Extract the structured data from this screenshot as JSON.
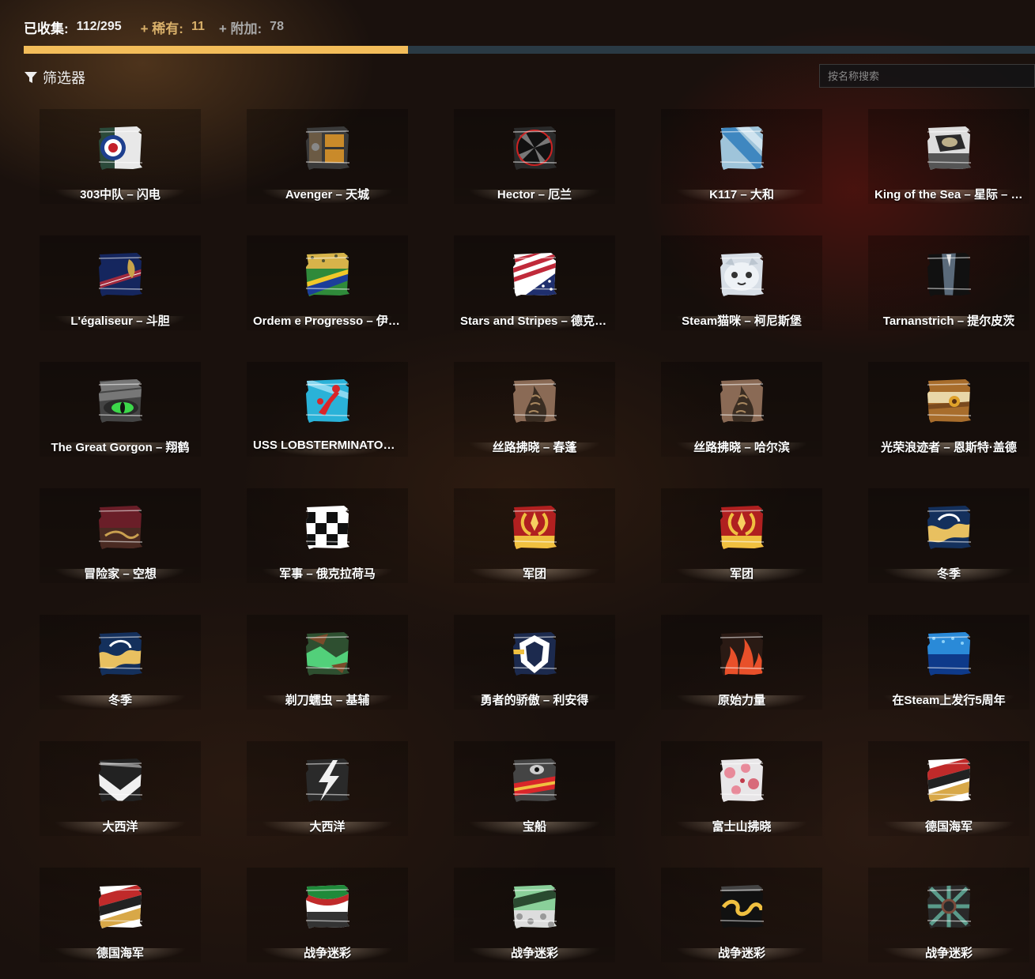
{
  "collection": {
    "collected_label": "已收集:",
    "collected_value": "112/295",
    "rare_label": "+ 稀有:",
    "rare_value": "11",
    "extra_label": "+ 附加:",
    "extra_value": "78",
    "progress_fraction": 0.38
  },
  "filter": {
    "label": "筛选器"
  },
  "search": {
    "placeholder": "按名称搜索"
  },
  "colors": {
    "accent": "#f3bd5a",
    "rare": "#d9b06a"
  },
  "items": [
    {
      "title": "303中队 – 闪电",
      "icon": "roundel-flag-icon"
    },
    {
      "title": "Avenger – 天城",
      "icon": "cargo-crate-icon"
    },
    {
      "title": "Hector – 厄兰",
      "icon": "turbine-icon"
    },
    {
      "title": "K117 – 大和",
      "icon": "blue-stripes-icon"
    },
    {
      "title": "King of the Sea – 星际 – 佛…",
      "icon": "sea-emblem-icon"
    },
    {
      "title": "L'égaliseur – 斗胆",
      "icon": "navy-gold-icon"
    },
    {
      "title": "Ordem e Progresso – 伊皮…",
      "icon": "brazil-leopard-icon"
    },
    {
      "title": "Stars and Stripes – 德克萨斯",
      "icon": "stars-stripes-icon"
    },
    {
      "title": "Steam猫咪 – 柯尼斯堡",
      "icon": "cat-face-icon"
    },
    {
      "title": "Tarnanstrich – 提尔皮茨",
      "icon": "dark-suit-icon"
    },
    {
      "title": "The Great Gorgon – 翔鹤",
      "icon": "serpent-eye-icon"
    },
    {
      "title": "USS LOBSTERMINATOR – …",
      "icon": "lobster-icon"
    },
    {
      "title": "丝路拂晓 – 春蓬",
      "icon": "dragon-scale-icon"
    },
    {
      "title": "丝路拂晓 – 哈尔滨",
      "icon": "dragon-scale-icon"
    },
    {
      "title": "光荣浪迹者 – 恩斯特·盖德",
      "icon": "wood-gem-icon"
    },
    {
      "title": "冒险家 – 空想",
      "icon": "maroon-scroll-icon"
    },
    {
      "title": "军事 – 俄克拉荷马",
      "icon": "checker-icon"
    },
    {
      "title": "军团",
      "icon": "laurel-red-icon"
    },
    {
      "title": "军团",
      "icon": "laurel-red-icon"
    },
    {
      "title": "冬季",
      "icon": "wave-blue-gold-icon"
    },
    {
      "title": "冬季",
      "icon": "wave-blue-gold-icon"
    },
    {
      "title": "剃刀蠕虫 – 基辅",
      "icon": "green-camo-icon"
    },
    {
      "title": "勇者的骄傲 – 利安得",
      "icon": "lion-head-icon"
    },
    {
      "title": "原始力量",
      "icon": "flames-icon"
    },
    {
      "title": "在Steam上发行5周年",
      "icon": "blue-halftone-icon"
    },
    {
      "title": "大西洋",
      "icon": "chevron-white-icon"
    },
    {
      "title": "大西洋",
      "icon": "lightning-white-icon"
    },
    {
      "title": "宝船",
      "icon": "treasure-ship-icon"
    },
    {
      "title": "富士山拂晓",
      "icon": "sakura-icon"
    },
    {
      "title": "德国海军",
      "icon": "german-navy-icon"
    },
    {
      "title": "德国海军",
      "icon": "german-navy-icon"
    },
    {
      "title": "战争迷彩",
      "icon": "italy-camo-icon"
    },
    {
      "title": "战争迷彩",
      "icon": "pebble-camo-icon"
    },
    {
      "title": "战争迷彩",
      "icon": "gold-swirl-icon"
    },
    {
      "title": "战争迷彩",
      "icon": "knot-pattern-icon"
    }
  ]
}
